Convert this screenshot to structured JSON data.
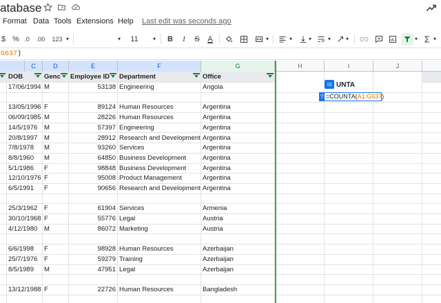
{
  "app": {
    "doc_title": "atabase",
    "star_icon": "star-icon",
    "move_icon": "folder-icon",
    "cloud_icon": "cloud-saved-icon",
    "trend_icon": "trend-icon"
  },
  "menu": {
    "items": [
      "Format",
      "Data",
      "Tools",
      "Extensions",
      "Help"
    ],
    "last_edit": "Last edit was seconds ago"
  },
  "toolbar": {
    "currency": "$",
    "percent": "%",
    "dec_decrease": ".0",
    "dec_increase": ".00",
    "more_formats": "123",
    "font_size": "11",
    "bold": "B",
    "italic": "I",
    "strike": "S",
    "text_color": "A"
  },
  "formula_bar": {
    "range": "G637",
    "paren": ")"
  },
  "columns": {
    "C": "C",
    "D": "D",
    "E": "E",
    "F": "F",
    "G": "G",
    "H": "H",
    "I": "I",
    "J": "J"
  },
  "headers": {
    "dob": "DOB",
    "gender": "Genc",
    "employee_id": "Employee ID",
    "department": "Department",
    "office": "Office"
  },
  "rows": [
    {
      "dob": "17/06/1994",
      "g": "M",
      "id": "53138",
      "dept": "Engineering",
      "office": "Angola"
    },
    {
      "dob": "",
      "g": "",
      "id": "",
      "dept": "",
      "office": ""
    },
    {
      "dob": "13/05/1996",
      "g": "F",
      "id": "89124",
      "dept": "Human Resources",
      "office": "Argentina"
    },
    {
      "dob": "06/09/1985",
      "g": "M",
      "id": "28226",
      "dept": "Human Resources",
      "office": "Argentina"
    },
    {
      "dob": "14/5/1976",
      "g": "M",
      "id": "57397",
      "dept": "Engineering",
      "office": "Argentina"
    },
    {
      "dob": "20/8/1997",
      "g": "M",
      "id": "28912",
      "dept": "Research and Development",
      "office": "Argentina"
    },
    {
      "dob": "7/8/1978",
      "g": "M",
      "id": "93260",
      "dept": "Services",
      "office": "Argentina"
    },
    {
      "dob": "8/8/1960",
      "g": "M",
      "id": "64850",
      "dept": "Business Development",
      "office": "Argentina"
    },
    {
      "dob": "5/1/1986",
      "g": "F",
      "id": "98848",
      "dept": "Business Development",
      "office": "Argentina"
    },
    {
      "dob": "12/10/1976",
      "g": "F",
      "id": "95008",
      "dept": "Product Management",
      "office": "Argentina"
    },
    {
      "dob": "6/5/1991",
      "g": "F",
      "id": "90656",
      "dept": "Research and Development",
      "office": "Argentina"
    },
    {
      "dob": "",
      "g": "",
      "id": "",
      "dept": "",
      "office": ""
    },
    {
      "dob": "25/3/1962",
      "g": "F",
      "id": "61904",
      "dept": "Services",
      "office": "Armenia"
    },
    {
      "dob": "30/10/1968",
      "g": "F",
      "id": "55776",
      "dept": "Legal",
      "office": "Austria"
    },
    {
      "dob": "4/12/1980",
      "g": "M",
      "id": "86072",
      "dept": "Marketing",
      "office": "Austria"
    },
    {
      "dob": "",
      "g": "",
      "id": "",
      "dept": "",
      "office": ""
    },
    {
      "dob": "6/6/1998",
      "g": "F",
      "id": "98928",
      "dept": "Human Resources",
      "office": "Azerbaijan"
    },
    {
      "dob": "25/7/1976",
      "g": "F",
      "id": "59279",
      "dept": "Training",
      "office": "Azerbaijan"
    },
    {
      "dob": "8/5/1989",
      "g": "M",
      "id": "47951",
      "dept": "Legal",
      "office": "Azerbaijan"
    },
    {
      "dob": "",
      "g": "",
      "id": "",
      "dept": "",
      "office": ""
    },
    {
      "dob": "13/12/1988",
      "g": "F",
      "id": "22726",
      "dept": "Human Resources",
      "office": "Bangladesh"
    },
    {
      "dob": "",
      "g": "",
      "id": "",
      "dept": "",
      "office": ""
    }
  ],
  "editor": {
    "ref_chip": "I3",
    "label": "UNTA",
    "help": "?",
    "func": "=COUNTA(",
    "range": "A1:G637",
    "close": ")"
  },
  "colors": {
    "accent": "#1a73e8",
    "filter_green": "#188038",
    "range_orange": "#e37400"
  }
}
